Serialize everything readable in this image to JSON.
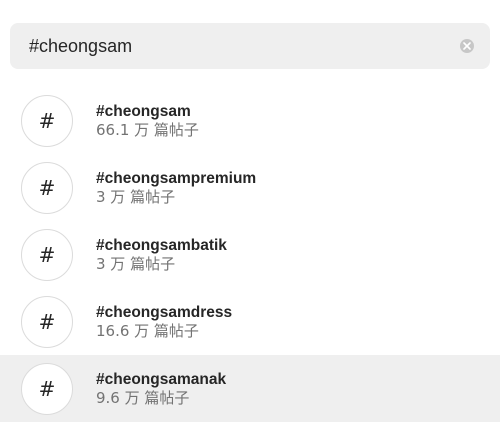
{
  "search": {
    "value": "#cheongsam",
    "clear_icon": "clear-icon"
  },
  "results": [
    {
      "tag": "#cheongsam",
      "count": "66.1 万 篇帖子",
      "icon": "#"
    },
    {
      "tag": "#cheongsampremium",
      "count": "3 万 篇帖子",
      "icon": "#"
    },
    {
      "tag": "#cheongsambatik",
      "count": "3 万 篇帖子",
      "icon": "#"
    },
    {
      "tag": "#cheongsamdress",
      "count": "16.6 万 篇帖子",
      "icon": "#"
    },
    {
      "tag": "#cheongsamanak",
      "count": "9.6 万 篇帖子",
      "icon": "#"
    }
  ],
  "colors": {
    "search_bg": "#efefef",
    "hover_bg": "#efefef",
    "text_primary": "#262626",
    "text_secondary": "#737373",
    "circle_border": "#dbdbdb"
  }
}
